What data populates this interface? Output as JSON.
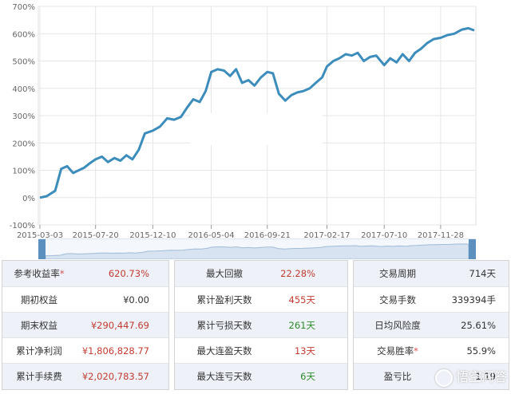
{
  "chart_data": {
    "type": "line",
    "ylim": [
      -100,
      700
    ],
    "yticks": [
      "-100%",
      "0%",
      "100%",
      "200%",
      "300%",
      "400%",
      "500%",
      "600%",
      "700%"
    ],
    "ytick_values": [
      -100,
      0,
      100,
      200,
      300,
      400,
      500,
      600,
      700
    ],
    "xticks": [
      "2015-03-03",
      "2015-07-20",
      "2015-12-10",
      "2016-05-04",
      "2016-09-21",
      "2017-02-17",
      "2017-07-10",
      "2017-11-28"
    ],
    "grid": true,
    "series": [
      {
        "color": "#3c8dbc",
        "x": [
          "2015-03-03",
          "2015-03-20",
          "2015-04-10",
          "2015-04-25",
          "2015-05-10",
          "2015-05-25",
          "2015-06-08",
          "2015-06-22",
          "2015-07-05",
          "2015-07-20",
          "2015-08-05",
          "2015-08-20",
          "2015-09-05",
          "2015-09-20",
          "2015-10-05",
          "2015-10-20",
          "2015-11-05",
          "2015-11-20",
          "2015-12-10",
          "2015-12-28",
          "2016-01-15",
          "2016-02-01",
          "2016-02-18",
          "2016-03-05",
          "2016-03-20",
          "2016-04-05",
          "2016-04-20",
          "2016-05-04",
          "2016-05-20",
          "2016-06-05",
          "2016-06-20",
          "2016-07-05",
          "2016-07-20",
          "2016-08-05",
          "2016-08-20",
          "2016-09-05",
          "2016-09-21",
          "2016-10-05",
          "2016-10-20",
          "2016-11-05",
          "2016-11-20",
          "2016-12-05",
          "2016-12-20",
          "2017-01-05",
          "2017-01-20",
          "2017-02-05",
          "2017-02-17",
          "2017-03-05",
          "2017-03-20",
          "2017-04-05",
          "2017-04-20",
          "2017-05-05",
          "2017-05-20",
          "2017-06-05",
          "2017-06-20",
          "2017-07-10",
          "2017-07-25",
          "2017-08-10",
          "2017-08-25",
          "2017-09-10",
          "2017-09-25",
          "2017-10-10",
          "2017-10-25",
          "2017-11-10",
          "2017-11-28",
          "2017-12-15",
          "2018-01-01",
          "2018-01-20",
          "2018-02-05",
          "2018-02-20"
        ],
        "values": [
          0,
          5,
          25,
          105,
          115,
          90,
          100,
          110,
          125,
          140,
          150,
          130,
          145,
          135,
          155,
          140,
          175,
          235,
          245,
          260,
          290,
          285,
          295,
          330,
          360,
          350,
          390,
          460,
          470,
          465,
          445,
          470,
          420,
          430,
          410,
          440,
          460,
          455,
          380,
          355,
          375,
          385,
          390,
          400,
          420,
          440,
          480,
          500,
          510,
          525,
          520,
          530,
          500,
          515,
          520,
          485,
          510,
          495,
          525,
          500,
          530,
          545,
          565,
          580,
          585,
          595,
          600,
          615,
          620,
          612
        ]
      }
    ]
  },
  "stats": {
    "panel1": [
      {
        "label": "参考收益率",
        "star": "*",
        "value": "620.73%",
        "tone": "red"
      },
      {
        "label": "期初权益",
        "star": "",
        "value": "¥0.00",
        "tone": "dark"
      },
      {
        "label": "期末权益",
        "star": "",
        "value": "¥290,447.69",
        "tone": "red"
      },
      {
        "label": "累计净利润",
        "star": "",
        "value": "¥1,806,828.77",
        "tone": "red"
      },
      {
        "label": "累计手续费",
        "star": "",
        "value": "¥2,020,783.57",
        "tone": "red"
      }
    ],
    "panel2": [
      {
        "label": "最大回撤",
        "star": "",
        "value": "22.28%",
        "tone": "red"
      },
      {
        "label": "累计盈利天数",
        "star": "",
        "value": "455天",
        "tone": "red"
      },
      {
        "label": "累计亏损天数",
        "star": "",
        "value": "261天",
        "tone": "green"
      },
      {
        "label": "最大连盈天数",
        "star": "",
        "value": "13天",
        "tone": "red"
      },
      {
        "label": "最大连亏天数",
        "star": "",
        "value": "6天",
        "tone": "green"
      }
    ],
    "panel3": [
      {
        "label": "交易周期",
        "star": "",
        "value": "714天",
        "tone": "dark"
      },
      {
        "label": "交易手数",
        "star": "",
        "value": "339394手",
        "tone": "dark"
      },
      {
        "label": "日均风险度",
        "star": "",
        "value": "25.61%",
        "tone": "dark"
      },
      {
        "label": "交易胜率",
        "star": "*",
        "value": "55.9%",
        "tone": "dark"
      },
      {
        "label": "盈亏比",
        "star": "",
        "value": "1.19",
        "tone": "dark"
      }
    ]
  },
  "watermark": {
    "text": "悟空问答"
  }
}
